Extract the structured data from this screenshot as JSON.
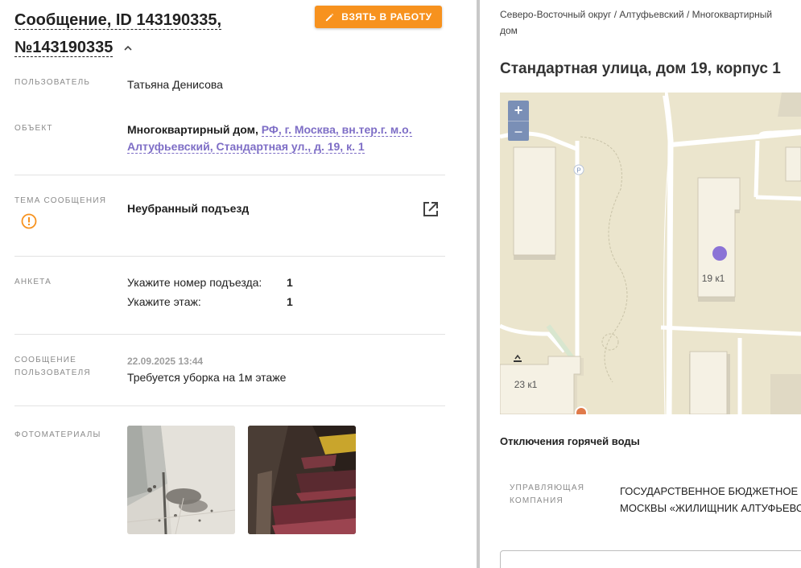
{
  "header": {
    "title": "Сообщение, ID 143190335, №143190335",
    "take_button": "ВЗЯТЬ В РАБОТУ"
  },
  "fields": {
    "user_label": "ПОЛЬЗОВАТЕЛЬ",
    "user_value": "Татьяна Денисова",
    "object_label": "ОБЪЕКТ",
    "object_type": "Многоквартирный дом,",
    "object_address": "РФ, г. Москва, вн.тер.г. м.о. Алтуфьевский, Стандартная ул., д. 19, к. 1",
    "topic_label": "ТЕМА СООБЩЕНИЯ",
    "topic_value": "Неубранный подъезд",
    "survey_label": "АНКЕТА",
    "survey": [
      {
        "question": "Укажите номер подъезда:",
        "answer": "1"
      },
      {
        "question": "Укажите этаж:",
        "answer": "1"
      }
    ],
    "message_label": "СООБЩЕНИЕ ПОЛЬЗОВАТЕЛЯ",
    "message_date": "22.09.2025 13:44",
    "message_text": "Требуется уборка на 1м этаже",
    "photos_label": "ФОТОМАТЕРИАЛЫ"
  },
  "right": {
    "breadcrumb": "Северо-Восточный округ / Алтуфьевский / Многоквартирный дом",
    "address": "Стандартная улица, дом 19, корпус 1",
    "map": {
      "zoom_in": "+",
      "zoom_out": "–",
      "label_building": "19 к1",
      "label_other": "23 к1",
      "parking": "P"
    },
    "hot_water": "Отключения горячей воды",
    "company_label": "УПРАВЛЯЮЩАЯ КОМПАНИЯ",
    "company_line1": "ГОСУДАРСТВЕННОЕ БЮДЖЕТНОЕ УЧРЕЖДЕНИЕ ГОРОДА",
    "company_line2": "МОСКВЫ «ЖИЛИЩНИК АЛТУФЬЕВСКОГО РАЙОНА»"
  },
  "colors": {
    "accent": "#f7921e",
    "link": "#7e6ec6",
    "marker": "#8b73d6"
  }
}
